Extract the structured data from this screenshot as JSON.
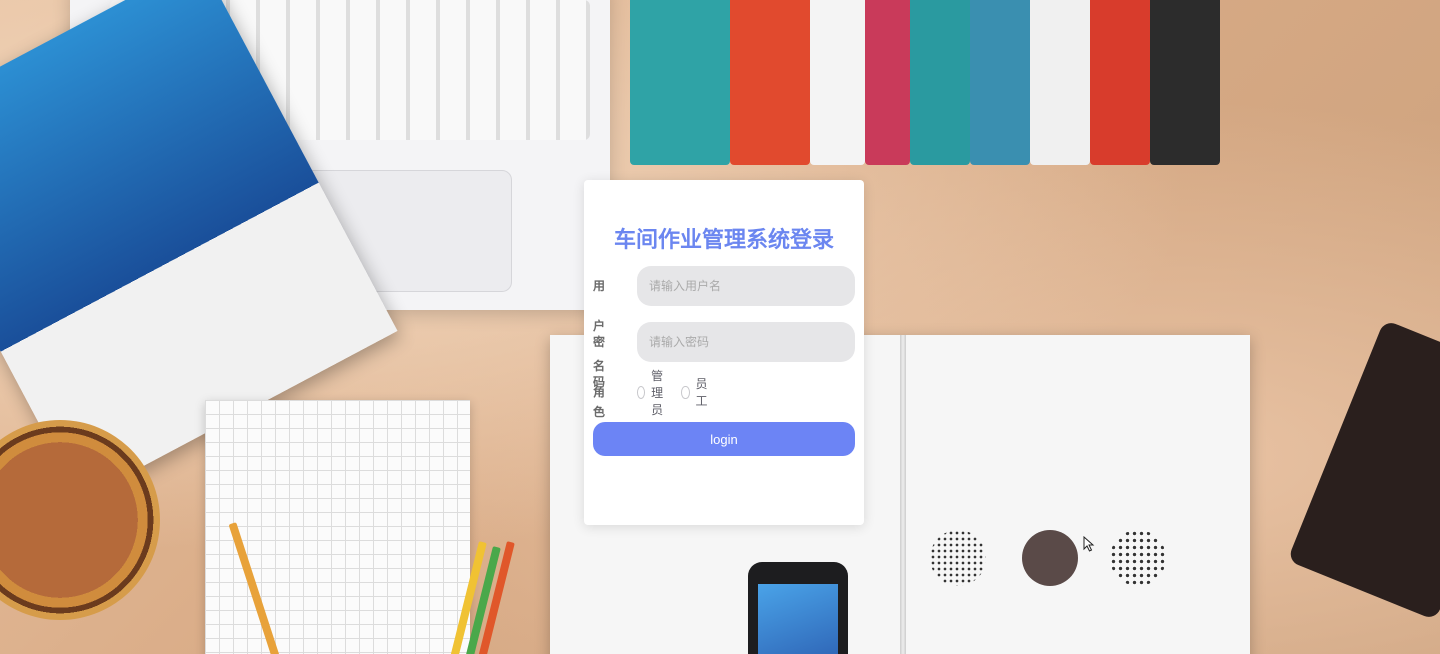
{
  "login": {
    "title": "车间作业管理系统登录",
    "username_label": "用户名",
    "username_placeholder": "请输入用户名",
    "password_label": "密码",
    "password_placeholder": "请输入密码",
    "role_label": "角色",
    "roles": [
      "管理员",
      "员工"
    ],
    "login_button": "login"
  },
  "colors": {
    "accent": "#6c84f5",
    "title": "#6b86f0",
    "input_bg": "#e6e6e8"
  }
}
